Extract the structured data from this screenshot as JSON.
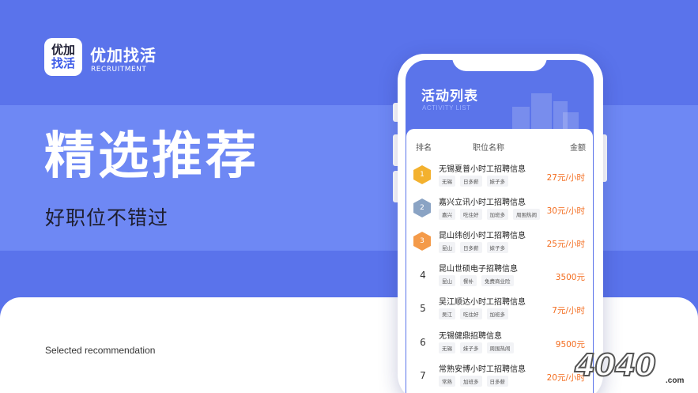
{
  "brand": {
    "logo_line1": "优加",
    "logo_line2": "找活",
    "name": "优加找活",
    "subtitle": "RECRUITMENT"
  },
  "hero": {
    "title": "精选推荐",
    "subtitle": "好职位不错过",
    "bottom_text": "Selected recommendation"
  },
  "screen": {
    "title": "活动列表",
    "subtitle": "ACTIVITY LIST",
    "columns": [
      "排名",
      "职位名称",
      "金额"
    ],
    "rows": [
      {
        "rank": "1",
        "title": "无锡夏普小时工招聘信息",
        "tags": [
          "无锡",
          "日多薪",
          "妹子多"
        ],
        "salary": "27元/小时",
        "medal": "gold"
      },
      {
        "rank": "2",
        "title": "嘉兴立讯小时工招聘信息",
        "tags": [
          "嘉兴",
          "吃住好",
          "加班多",
          "周围热闹"
        ],
        "salary": "30元/小时",
        "medal": "silver"
      },
      {
        "rank": "3",
        "title": "昆山纬创小时工招聘信息",
        "tags": [
          "昆山",
          "日多薪",
          "妹子多"
        ],
        "salary": "25元/小时",
        "medal": "bronze"
      },
      {
        "rank": "4",
        "title": "昆山世硕电子招聘信息",
        "tags": [
          "昆山",
          "餐补",
          "免费商业险"
        ],
        "salary": "3500元",
        "medal": ""
      },
      {
        "rank": "5",
        "title": "吴江顺达小时工招聘信息",
        "tags": [
          "吴江",
          "吃住好",
          "加班多"
        ],
        "salary": "7元/小时",
        "medal": ""
      },
      {
        "rank": "6",
        "title": "无锡健鼎招聘信息",
        "tags": [
          "无锡",
          "妹子多",
          "周围热闹"
        ],
        "salary": "9500元",
        "medal": ""
      },
      {
        "rank": "7",
        "title": "常熟安博小时工招聘信息",
        "tags": [
          "常熟",
          "加班多",
          "日多薪"
        ],
        "salary": "20元/小时",
        "medal": ""
      }
    ]
  },
  "watermark": {
    "text": "4040",
    "suffix": ".com"
  },
  "colors": {
    "primary": "#5a73eb",
    "band": "#6e88f4",
    "salary": "#f36c1e"
  }
}
